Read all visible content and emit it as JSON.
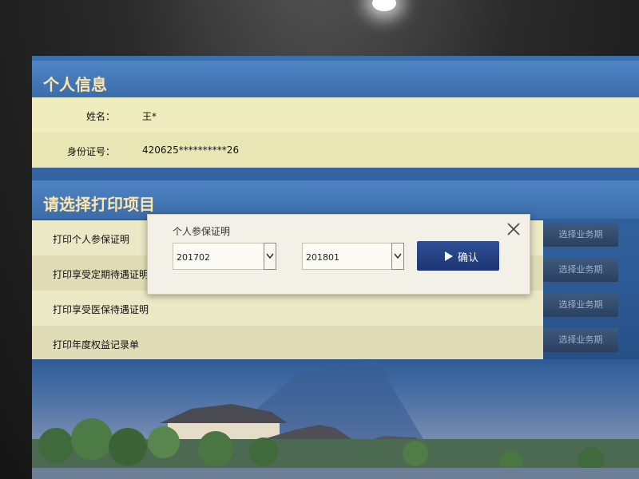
{
  "personal_info": {
    "title": "个人信息",
    "name_label": "姓名：",
    "name_value": "王*",
    "id_label": "身份证号：",
    "id_value": "420625**********26"
  },
  "print_section": {
    "title": "请选择打印项目",
    "items": [
      {
        "label": "打印个人参保证明",
        "button": "选择业务期"
      },
      {
        "label": "打印享受定期待遇证明",
        "button": "选择业务期"
      },
      {
        "label": "打印享受医保待遇证明",
        "button": "选择业务期"
      },
      {
        "label": "打印年度权益记录单",
        "button": "选择业务期"
      }
    ]
  },
  "dialog": {
    "title": "个人参保证明",
    "start_period": "201702",
    "end_period": "201801",
    "confirm_label": "确认"
  },
  "colors": {
    "panel_title_text": "#ffe6a8",
    "row_background": "#efecbd",
    "confirm_button": "#1d3573"
  },
  "icons": {
    "close": "close-icon",
    "dropdown": "chevron-down-icon",
    "confirm": "play-icon"
  }
}
